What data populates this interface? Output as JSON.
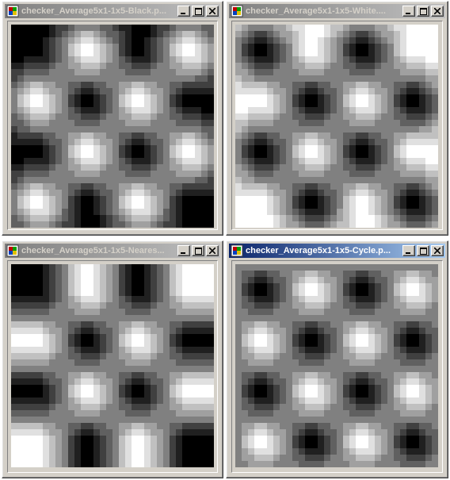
{
  "windows": [
    {
      "id": "black",
      "title": "checker_Average5x1-1x5-Black.p...",
      "active": false,
      "background_color": "#000000"
    },
    {
      "id": "white",
      "title": "checker_Average5x1-1x5-White....",
      "active": false,
      "background_color": "#ffffff"
    },
    {
      "id": "nearest",
      "title": "checker_Average5x1-1x5-Neares...",
      "active": false,
      "background_color": "edge-extend"
    },
    {
      "id": "cycle",
      "title": "checker_Average5x1-1x5-Cycle.p...",
      "active": true,
      "background_color": "tile"
    }
  ],
  "title_buttons": [
    "minimize-icon",
    "maximize-icon",
    "close-icon"
  ],
  "colors": {
    "window_face": "#d4d0c8",
    "active_title_start": "#0a246a",
    "active_title_end": "#a6caf0",
    "inactive_title_start": "#808080",
    "inactive_title_end": "#c0c0c0",
    "checker_dark": "#000000",
    "checker_light": "#ffffff"
  }
}
